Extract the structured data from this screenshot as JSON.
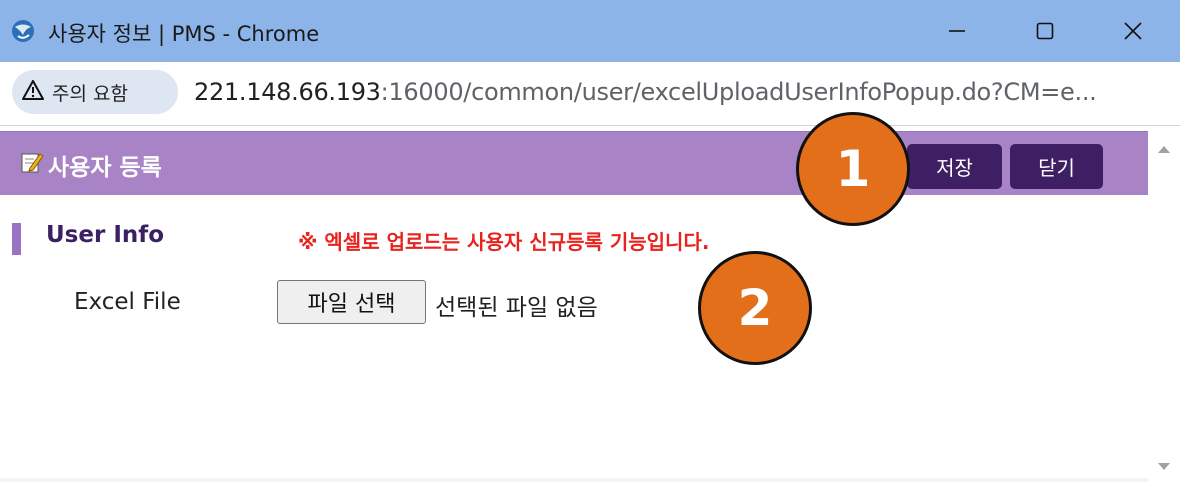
{
  "window": {
    "title": "사용자 정보 | PMS - Chrome",
    "icon": "app-globe-icon",
    "controls": [
      "minimize-icon",
      "maximize-icon",
      "close-icon"
    ]
  },
  "address_bar": {
    "security_label": "주의 요함",
    "url_host": "221.148.66.193",
    "url_rest": ":16000/common/user/excelUploadUserInfoPopup.do?CM=e..."
  },
  "popup": {
    "title": "사용자 등록",
    "save_label": "저장",
    "close_label": "닫기"
  },
  "form": {
    "section_title": "User Info",
    "notice": "※ 엑셀로 업로드는 사용자 신규등록 기능입니다.",
    "field_label": "Excel File",
    "file_button_label": "파일 선택",
    "file_status": "선택된 파일 없음"
  },
  "annotations": {
    "badge_1": "1",
    "badge_2": "2"
  },
  "colors": {
    "titlebar": "#8db4e8",
    "header": "#a884c7",
    "header_button": "#3e1f64",
    "notice": "#e8231e",
    "badge": "#e46f1b"
  }
}
